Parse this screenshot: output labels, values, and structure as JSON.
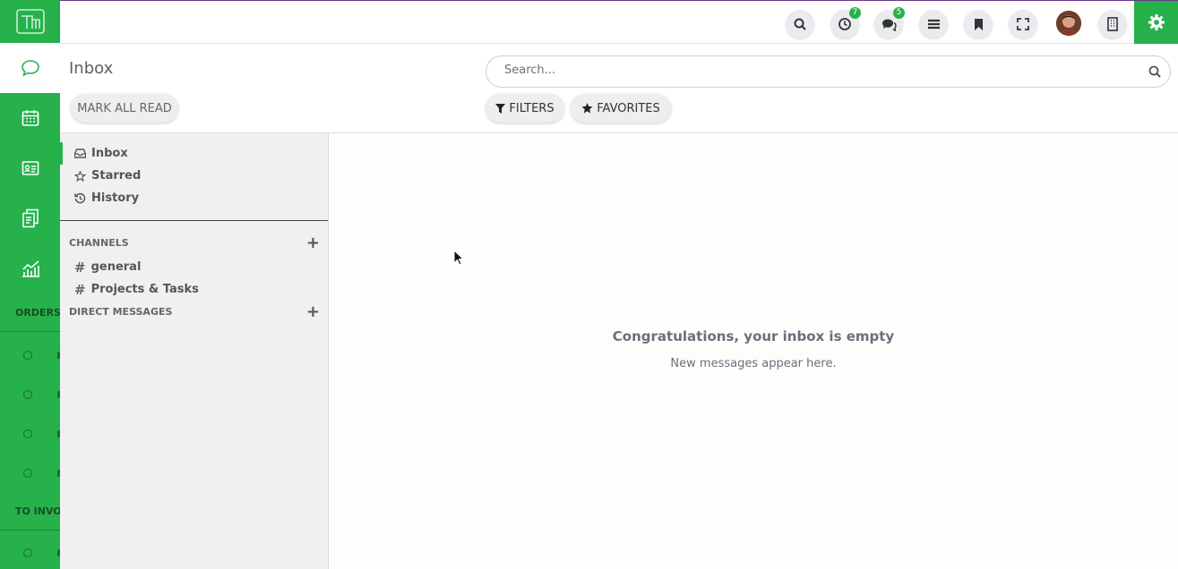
{
  "sidebar": {
    "sections": [
      {
        "label": "ORDERS"
      },
      {
        "label": "TO INVO"
      }
    ]
  },
  "topbar": {
    "badges": {
      "activities": "7",
      "messages": "5"
    }
  },
  "control_panel": {
    "title": "Inbox",
    "mark_all_read": "MARK ALL READ",
    "search_placeholder": "Search...",
    "filters": "FILTERS",
    "favorites": "FAVORITES"
  },
  "mailboxes": [
    {
      "label": "Inbox"
    },
    {
      "label": "Starred"
    },
    {
      "label": "History"
    }
  ],
  "channels": {
    "header": "CHANNELS",
    "items": [
      {
        "label": "general"
      },
      {
        "label": "Projects & Tasks"
      }
    ]
  },
  "direct_messages": {
    "header": "DIRECT MESSAGES"
  },
  "empty_state": {
    "title": "Congratulations, your inbox is empty",
    "subtitle": "New messages appear here."
  },
  "colors": {
    "accent": "#26b14b",
    "sidebar": "#26b14b"
  }
}
